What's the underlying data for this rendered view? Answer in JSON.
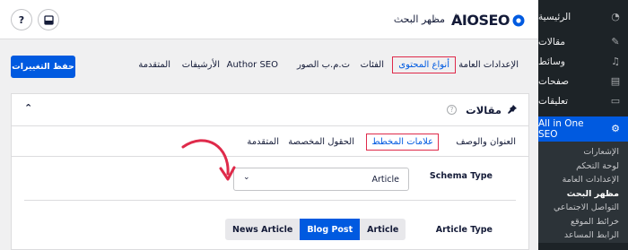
{
  "sidebar": {
    "items": [
      {
        "label": "الرئيسية",
        "icon": "dashboard-icon"
      },
      {
        "label": "مقالات",
        "icon": "pin-icon"
      },
      {
        "label": "وسائط",
        "icon": "media-icon"
      },
      {
        "label": "صفحات",
        "icon": "pages-icon"
      },
      {
        "label": "تعليقات",
        "icon": "comments-icon"
      }
    ],
    "active": {
      "label": "All in One SEO",
      "icon": "aioseo-icon"
    },
    "submenu": [
      {
        "label": "الإشعارات",
        "current": false
      },
      {
        "label": "لوحة التحكم",
        "current": false
      },
      {
        "label": "الإعدادات العامة",
        "current": false
      },
      {
        "label": "مظهر البحث",
        "current": true
      },
      {
        "label": "التواصل الاجتماعي",
        "current": false
      },
      {
        "label": "خرائط الموقع",
        "current": false
      },
      {
        "label": "الرابط المساعد",
        "current": false
      }
    ]
  },
  "header": {
    "logo_text": "AIOSEO",
    "page_title": "مظهر البحث",
    "separator": "\\"
  },
  "toolbar": {
    "save_label": "حفظ التغييرات"
  },
  "tabs": [
    {
      "label": "الإعدادات العامة",
      "active": false
    },
    {
      "label": "أنواع المحتوى",
      "active": true
    },
    {
      "label": "الفئات",
      "active": false
    },
    {
      "label": "ت.م.ب الصور",
      "active": false
    },
    {
      "label": "Author SEO",
      "active": false
    },
    {
      "label": "الأرشيفات",
      "active": false
    },
    {
      "label": "المتقدمة",
      "active": false
    }
  ],
  "panel": {
    "title": "مقالات",
    "help": "?",
    "subtabs": [
      {
        "label": "العنوان والوصف",
        "active": false
      },
      {
        "label": "علامات المخطط",
        "active": true
      },
      {
        "label": "الحقول المخصصة",
        "active": false
      },
      {
        "label": "المتقدمة",
        "active": false
      }
    ],
    "schema_type": {
      "label": "Schema Type",
      "value": "Article"
    },
    "article_type": {
      "label": "Article Type",
      "options": [
        "News Article",
        "Blog Post",
        "Article"
      ],
      "selected": "Blog Post"
    }
  },
  "colors": {
    "accent": "#005ae0",
    "highlight": "#df2a4a",
    "sidebar_bg": "#1d2327"
  }
}
